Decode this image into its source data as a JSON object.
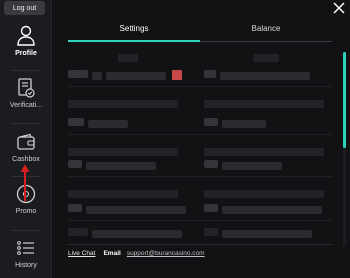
{
  "sidebar": {
    "logout_label": "Log out",
    "items": [
      {
        "label": "Profile",
        "icon": "user-icon",
        "active": true
      },
      {
        "label": "Verificati...",
        "icon": "document-check-icon"
      },
      {
        "label": "Cashbox",
        "icon": "wallet-icon"
      },
      {
        "label": "Promo",
        "icon": "promo-icon"
      },
      {
        "label": "History",
        "icon": "list-icon"
      }
    ]
  },
  "tabs": [
    {
      "label": "Settings",
      "active": true
    },
    {
      "label": "Balance"
    }
  ],
  "footer": {
    "live_chat": "Live Chat",
    "email_label": "Email",
    "email_value": "support@burancasino.com"
  },
  "colors": {
    "accent": "#2fd0c0",
    "annotation_arrow": "#d62020",
    "red_block": "#c94747"
  }
}
